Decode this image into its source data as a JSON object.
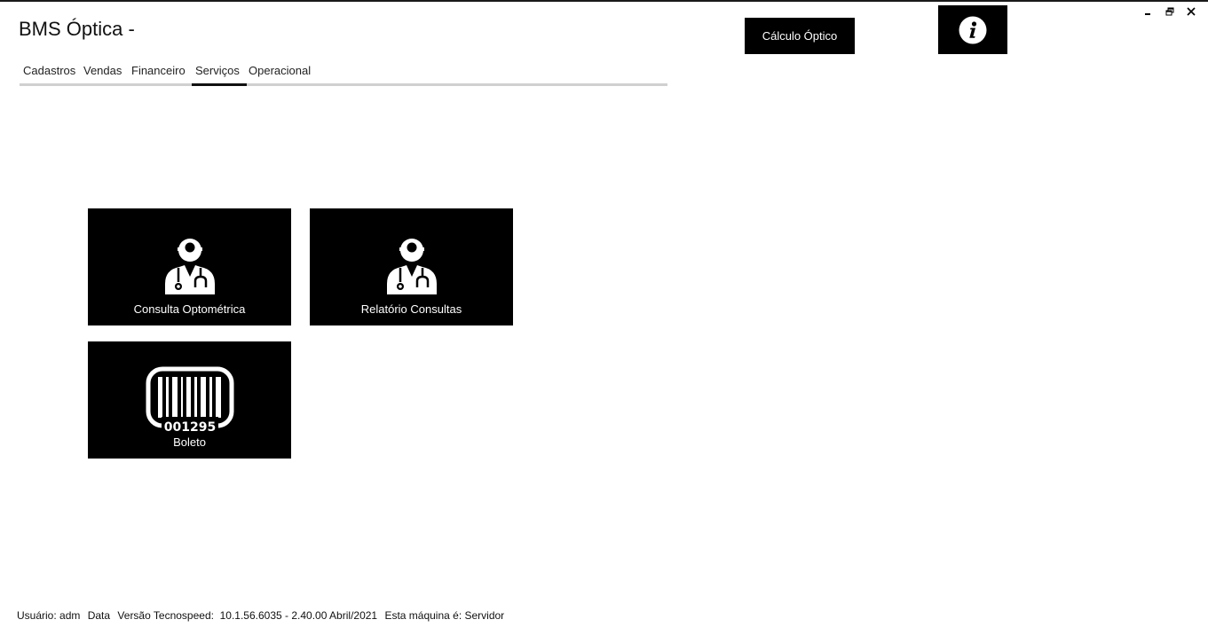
{
  "app": {
    "title": "BMS Óptica -"
  },
  "tabs": [
    {
      "label": "Cadastros",
      "active": false
    },
    {
      "label": "Vendas",
      "active": false
    },
    {
      "label": "Financeiro",
      "active": false
    },
    {
      "label": "Serviços",
      "active": true
    },
    {
      "label": "Operacional",
      "active": false
    }
  ],
  "header": {
    "calc_button_label": "Cálculo Óptico",
    "info_icon": "info-icon"
  },
  "window_controls": {
    "minimize": "minimize-icon",
    "restore": "restore-icon",
    "close": "close-icon"
  },
  "tiles": [
    {
      "label": "Consulta Optométrica",
      "icon": "doctor-icon"
    },
    {
      "label": "Relatório Consultas",
      "icon": "doctor-icon"
    },
    {
      "label": "Boleto",
      "icon": "barcode-icon",
      "barcode_number": "001295"
    }
  ],
  "status": {
    "user": "Usuário: adm",
    "date": "Data",
    "version": "Versão Tecnospeed:  10.1.56.6035 - 2.40.00 Abril/2021",
    "machine": "Esta máquina é: Servidor"
  },
  "colors": {
    "tile_bg": "#000000",
    "tab_underline": "#d0d0d0",
    "active_tab_underline": "#111111"
  }
}
